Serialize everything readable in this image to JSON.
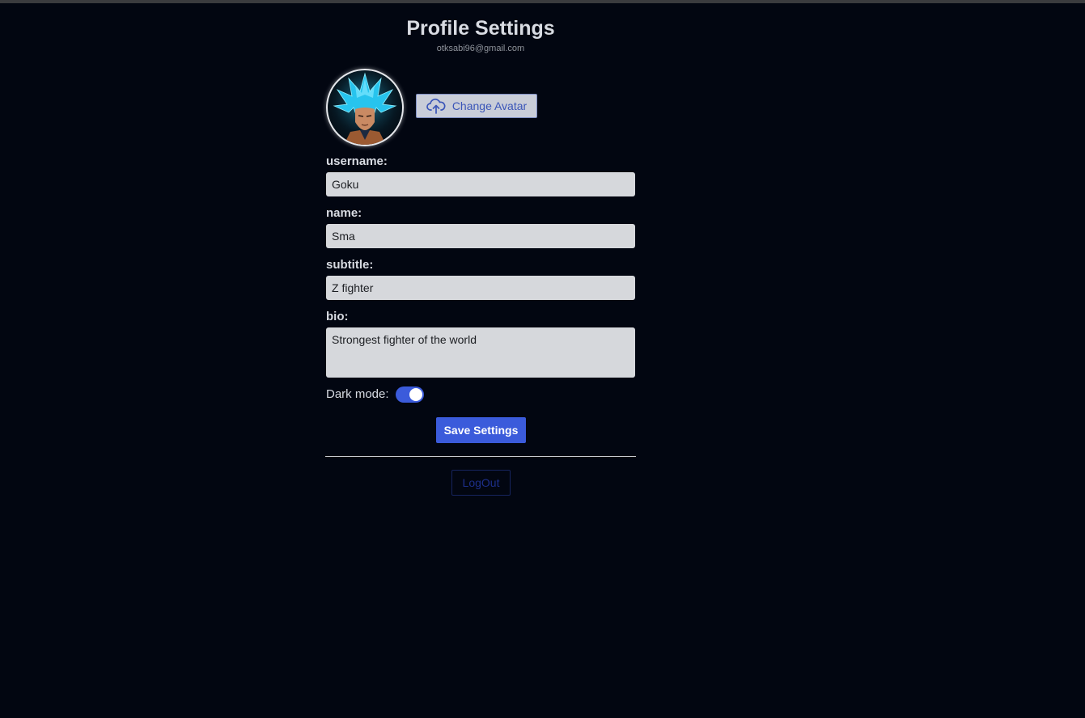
{
  "page": {
    "title": "Profile Settings",
    "email": "otksabi96@gmail.com"
  },
  "avatar": {
    "change_label": "Change Avatar",
    "icon": "cloud-upload-icon"
  },
  "form": {
    "username": {
      "label": "username:",
      "value": "Goku"
    },
    "name": {
      "label": "name:",
      "value": "Sma"
    },
    "subtitle": {
      "label": "subtitle:",
      "value": "Z fighter"
    },
    "bio": {
      "label": "bio:",
      "value": "Strongest fighter of the world"
    },
    "dark_mode": {
      "label": "Dark mode:",
      "enabled": true
    }
  },
  "actions": {
    "save_label": "Save Settings",
    "logout_label": "LogOut"
  },
  "colors": {
    "background": "#020611",
    "accent": "#3b5bdb",
    "input_bg": "#d6d8dc",
    "text_light": "#d8dbe2"
  }
}
